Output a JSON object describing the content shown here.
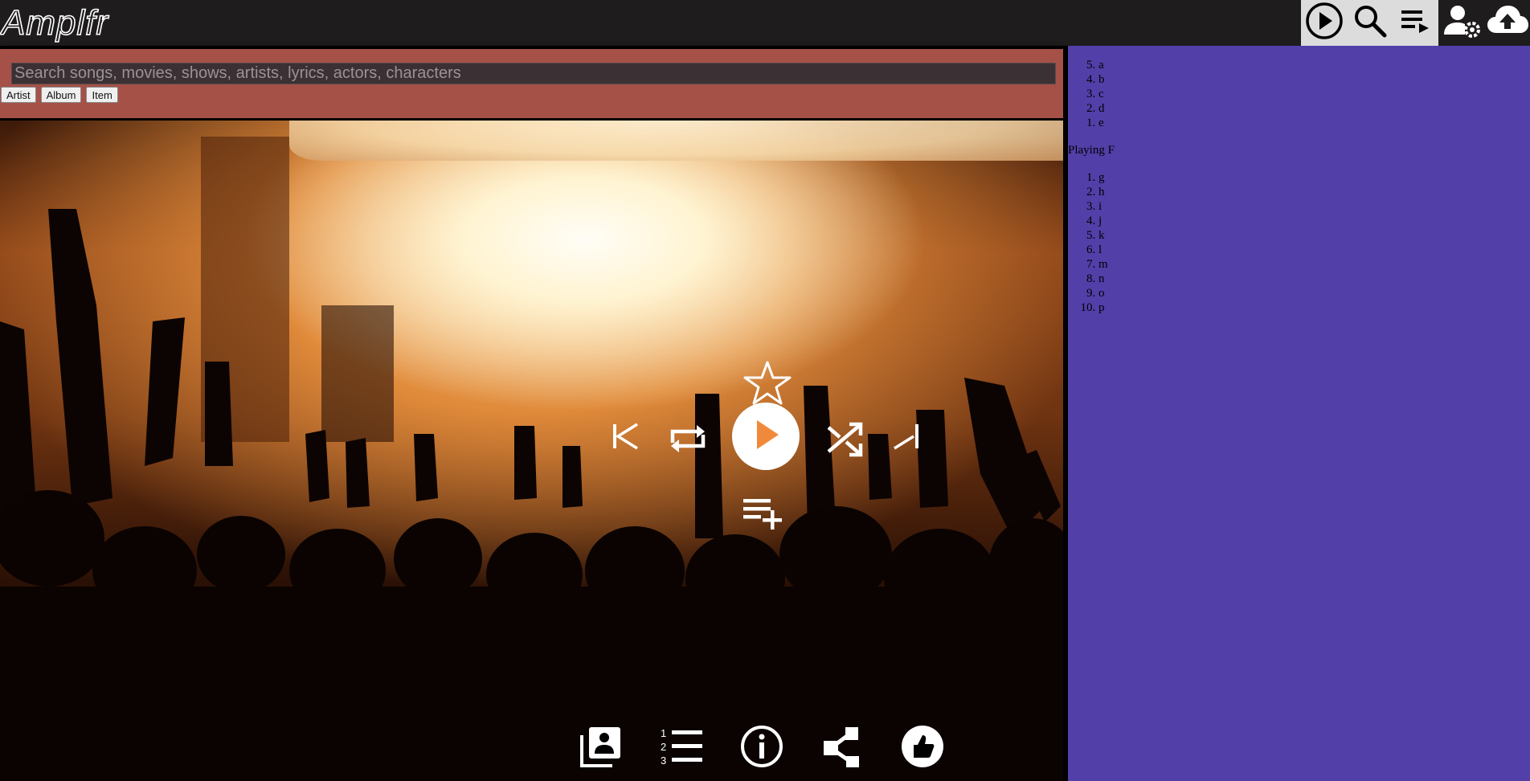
{
  "app": {
    "logo_text": "Amplfr"
  },
  "top_nav": {
    "icons": [
      "play-circle-icon",
      "search-icon",
      "queue-icon",
      "user-settings-icon",
      "upload-icon"
    ]
  },
  "search": {
    "placeholder": "Search songs, movies, shows, artists, lyrics, actors, characters",
    "value": "",
    "filters": [
      "Artist",
      "Album",
      "Item"
    ]
  },
  "player": {
    "state": "paused",
    "controls": [
      "star-icon",
      "skip-previous-icon",
      "repeat-icon",
      "play-icon",
      "shuffle-icon",
      "skip-next-icon",
      "playlist-add-icon"
    ],
    "bottom_actions": [
      "library-icon",
      "numbered-list-icon",
      "info-icon",
      "share-icon",
      "thumbs-up-icon"
    ]
  },
  "colors": {
    "topbar": "#1e1c1d",
    "search_panel": "#a55148",
    "sidebar": "#523fa8",
    "active_nav": "#dcdcdc"
  },
  "sidebar": {
    "history": [
      {
        "num": 5,
        "label": "a"
      },
      {
        "num": 4,
        "label": "b"
      },
      {
        "num": 3,
        "label": "c"
      },
      {
        "num": 2,
        "label": "d"
      },
      {
        "num": 1,
        "label": "e"
      }
    ],
    "now_playing": "Playing F",
    "queue": [
      "g",
      "h",
      "i",
      "j",
      "k",
      "l",
      "m",
      "n",
      "o",
      "p"
    ]
  }
}
